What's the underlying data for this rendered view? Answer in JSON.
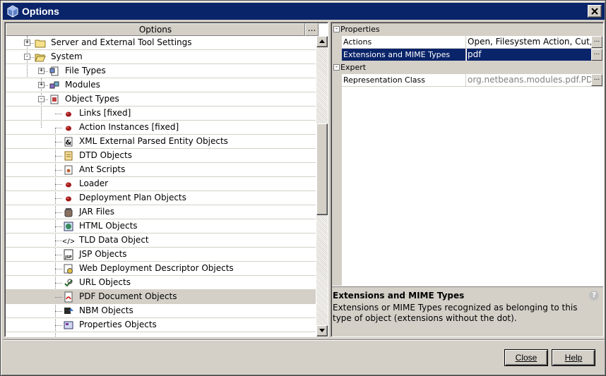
{
  "window": {
    "title": "Options"
  },
  "left": {
    "column_header": "Options",
    "column_more": "...",
    "tree": [
      {
        "label": "Server and External Tool Settings",
        "level": 1,
        "toggle": "+",
        "icon": "folder-icon"
      },
      {
        "label": "System",
        "level": 1,
        "toggle": "-",
        "icon": "folder-open-icon"
      },
      {
        "label": "File Types",
        "level": 2,
        "toggle": "+",
        "icon": "file-types-icon"
      },
      {
        "label": "Modules",
        "level": 2,
        "toggle": "+",
        "icon": "modules-icon"
      },
      {
        "label": "Object Types",
        "level": 2,
        "toggle": "-",
        "icon": "object-types-icon"
      },
      {
        "label": "Links [fixed]",
        "level": 3,
        "icon": "bean-icon"
      },
      {
        "label": "Action Instances [fixed]",
        "level": 3,
        "icon": "bean-icon"
      },
      {
        "label": "XML External Parsed Entity Objects",
        "level": 3,
        "icon": "xml-entity-icon"
      },
      {
        "label": "DTD Objects",
        "level": 3,
        "icon": "dtd-icon"
      },
      {
        "label": "Ant Scripts",
        "level": 3,
        "icon": "ant-script-icon"
      },
      {
        "label": "Loader",
        "level": 3,
        "icon": "bean-icon"
      },
      {
        "label": "Deployment Plan Objects",
        "level": 3,
        "icon": "bean-icon"
      },
      {
        "label": "JAR Files",
        "level": 3,
        "icon": "jar-icon"
      },
      {
        "label": "HTML Objects",
        "level": 3,
        "icon": "html-icon"
      },
      {
        "label": "TLD Data Object",
        "level": 3,
        "icon": "tld-icon"
      },
      {
        "label": "JSP Objects",
        "level": 3,
        "icon": "jsp-icon"
      },
      {
        "label": "Web Deployment Descriptor Objects",
        "level": 3,
        "icon": "web-descriptor-icon"
      },
      {
        "label": "URL Objects",
        "level": 3,
        "icon": "url-icon"
      },
      {
        "label": "PDF Document Objects",
        "level": 3,
        "icon": "pdf-icon",
        "selected": true
      },
      {
        "label": "NBM Objects",
        "level": 3,
        "icon": "nbm-icon"
      },
      {
        "label": "Properties Objects",
        "level": 3,
        "icon": "properties-icon"
      }
    ]
  },
  "properties": {
    "categories": [
      {
        "name": "Properties",
        "toggle": "-",
        "rows": [
          {
            "name": "Actions",
            "value": "Open, Filesystem Action, Cut, Co",
            "button": "..."
          },
          {
            "name": "Extensions and MIME Types",
            "value": "pdf",
            "button": "...",
            "selected": true
          }
        ]
      },
      {
        "name": "Expert",
        "toggle": "-",
        "rows": [
          {
            "name": "Representation Class",
            "value": "org.netbeans.modules.pdf.PDFD",
            "button": "...",
            "disabled": true
          }
        ]
      }
    ]
  },
  "description": {
    "title": "Extensions and MIME Types",
    "text": "Extensions or MIME Types recognized as belonging to this type of object (extensions without the dot).",
    "help_glyph": "?"
  },
  "buttons": {
    "close": "Close",
    "help": "Help"
  },
  "colors": {
    "titlebar": "#0a246a",
    "selection": "#0a246a",
    "chrome": "#d4d0c8"
  }
}
